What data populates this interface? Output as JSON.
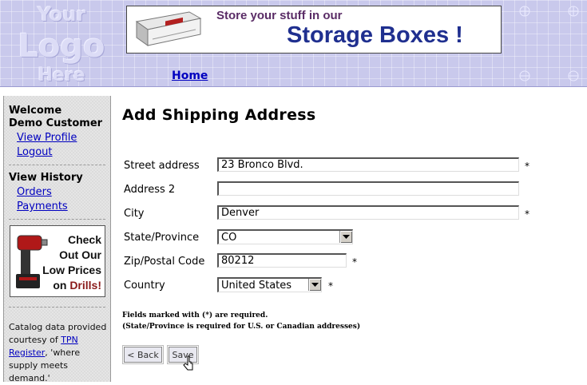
{
  "header": {
    "logo_line1": "Your",
    "logo_line2": "Logo",
    "logo_line3": "Here",
    "banner_line1": "Store your stuff in our",
    "banner_line2": "Storage Boxes !",
    "home_link": "Home"
  },
  "sidebar": {
    "welcome_line1": "Welcome",
    "welcome_line2": "Demo Customer",
    "view_profile": "View Profile",
    "logout": "Logout",
    "history_heading": "View History",
    "orders": "Orders",
    "payments": "Payments",
    "drill_ad": {
      "line1": "Check",
      "line2": "Out Our",
      "line3": "Low Prices",
      "line4_prefix": "on ",
      "line4_highlight": "Drills!"
    },
    "catalog_prefix": "Catalog data provided courtesy of ",
    "catalog_link": "TPN Register",
    "catalog_suffix": ", 'where supply meets demand.'"
  },
  "main": {
    "title": "Add Shipping Address",
    "fields": {
      "street": {
        "label": "Street address",
        "value": "23 Bronco Blvd.",
        "required": "*"
      },
      "address2": {
        "label": "Address 2",
        "value": ""
      },
      "city": {
        "label": "City",
        "value": "Denver",
        "required": "*"
      },
      "state": {
        "label": "State/Province",
        "value": "CO"
      },
      "zip": {
        "label": "Zip/Postal Code",
        "value": "80212",
        "required": "*"
      },
      "country": {
        "label": "Country",
        "value": "United States",
        "required": "*"
      }
    },
    "note1": "Fields marked with (*) are required.",
    "note2": "(State/Province is required for U.S. or Canadian addresses)",
    "back_button": "< Back",
    "save_button": "Save"
  },
  "colors": {
    "header_bg": "#c9c9ec",
    "link": "#0000c0",
    "banner_accent": "#1f2f8f"
  },
  "icons": [
    "toolbox-image",
    "drill-image",
    "chevron-down-icon",
    "mouse-pointer-icon"
  ]
}
